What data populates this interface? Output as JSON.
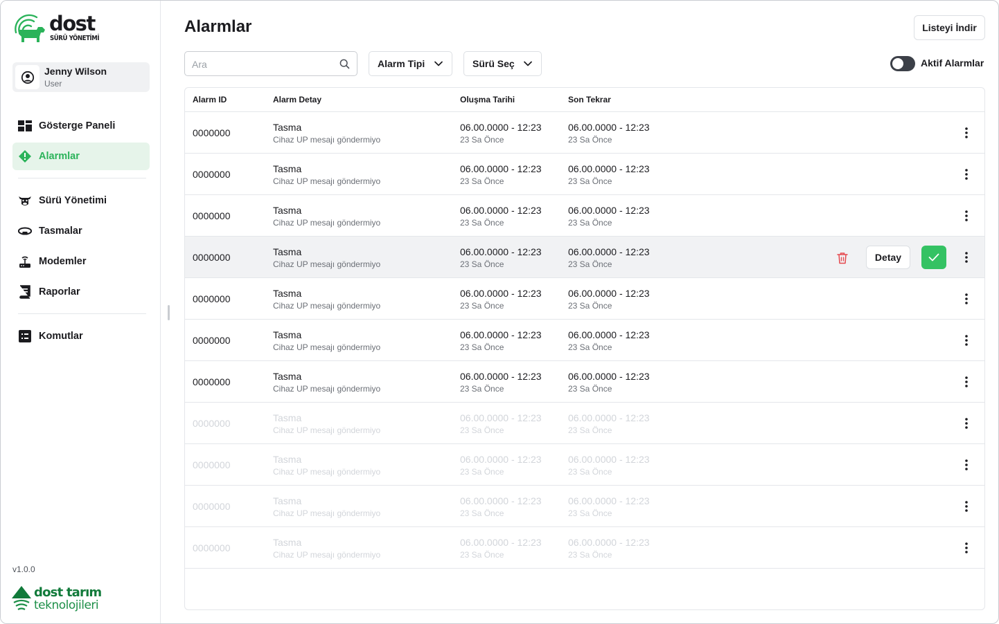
{
  "app": {
    "logo_text": "dost",
    "logo_sub": "SÜRÜ YÖNETİMİ",
    "version": "v1.0.0",
    "brand_line1": "dost tarım",
    "brand_line2": "teknolojileri"
  },
  "user": {
    "name": "Jenny Wilson",
    "role": "User"
  },
  "nav": {
    "dashboard": "Gösterge Paneli",
    "alarms": "Alarmlar",
    "herd": "Sürü Yönetimi",
    "collars": "Tasmalar",
    "modems": "Modemler",
    "reports": "Raporlar",
    "commands": "Komutlar"
  },
  "header": {
    "title": "Alarmlar",
    "download_label": "Listeyi İndir",
    "search_placeholder": "Ara",
    "alarm_type_label": "Alarm Tipi",
    "herd_select_label": "Sürü Seç",
    "active_toggle_label": "Aktif Alarmlar"
  },
  "table": {
    "columns": [
      "Alarm ID",
      "Alarm Detay",
      "Oluşma Tarihi",
      "Son Tekrar"
    ],
    "detail_button": "Detay",
    "rows": [
      {
        "id": "0000000",
        "title": "Tasma",
        "desc": "Cihaz UP mesajı göndermiyo",
        "created": "06.00.0000 - 12:23",
        "created_ago": "23 Sa Önce",
        "last": "06.00.0000 - 12:23",
        "last_ago": "23 Sa Önce"
      },
      {
        "id": "0000000",
        "title": "Tasma",
        "desc": "Cihaz UP mesajı göndermiyo",
        "created": "06.00.0000 - 12:23",
        "created_ago": "23 Sa Önce",
        "last": "06.00.0000 - 12:23",
        "last_ago": "23 Sa Önce"
      },
      {
        "id": "0000000",
        "title": "Tasma",
        "desc": "Cihaz UP mesajı göndermiyo",
        "created": "06.00.0000 - 12:23",
        "created_ago": "23 Sa Önce",
        "last": "06.00.0000 - 12:23",
        "last_ago": "23 Sa Önce"
      },
      {
        "id": "0000000",
        "title": "Tasma",
        "desc": "Cihaz UP mesajı göndermiyo",
        "created": "06.00.0000 - 12:23",
        "created_ago": "23 Sa Önce",
        "last": "06.00.0000 - 12:23",
        "last_ago": "23 Sa Önce"
      },
      {
        "id": "0000000",
        "title": "Tasma",
        "desc": "Cihaz UP mesajı göndermiyo",
        "created": "06.00.0000 - 12:23",
        "created_ago": "23 Sa Önce",
        "last": "06.00.0000 - 12:23",
        "last_ago": "23 Sa Önce"
      },
      {
        "id": "0000000",
        "title": "Tasma",
        "desc": "Cihaz UP mesajı göndermiyo",
        "created": "06.00.0000 - 12:23",
        "created_ago": "23 Sa Önce",
        "last": "06.00.0000 - 12:23",
        "last_ago": "23 Sa Önce"
      },
      {
        "id": "0000000",
        "title": "Tasma",
        "desc": "Cihaz UP mesajı göndermiyo",
        "created": "06.00.0000 - 12:23",
        "created_ago": "23 Sa Önce",
        "last": "06.00.0000 - 12:23",
        "last_ago": "23 Sa Önce"
      },
      {
        "id": "0000000",
        "title": "Tasma",
        "desc": "Cihaz UP mesajı göndermiyo",
        "created": "06.00.0000 - 12:23",
        "created_ago": "23 Sa Önce",
        "last": "06.00.0000 - 12:23",
        "last_ago": "23 Sa Önce"
      },
      {
        "id": "0000000",
        "title": "Tasma",
        "desc": "Cihaz UP mesajı göndermiyo",
        "created": "06.00.0000 - 12:23",
        "created_ago": "23 Sa Önce",
        "last": "06.00.0000 - 12:23",
        "last_ago": "23 Sa Önce"
      },
      {
        "id": "0000000",
        "title": "Tasma",
        "desc": "Cihaz UP mesajı göndermiyo",
        "created": "06.00.0000 - 12:23",
        "created_ago": "23 Sa Önce",
        "last": "06.00.0000 - 12:23",
        "last_ago": "23 Sa Önce"
      },
      {
        "id": "0000000",
        "title": "Tasma",
        "desc": "Cihaz UP mesajı göndermiyo",
        "created": "06.00.0000 - 12:23",
        "created_ago": "23 Sa Önce",
        "last": "06.00.0000 - 12:23",
        "last_ago": "23 Sa Önce"
      }
    ]
  },
  "colors": {
    "accent_green": "#2bb35a",
    "confirm_green": "#34c263",
    "delete_red": "#e5484d",
    "active_nav_bg": "#e6f4ea"
  }
}
